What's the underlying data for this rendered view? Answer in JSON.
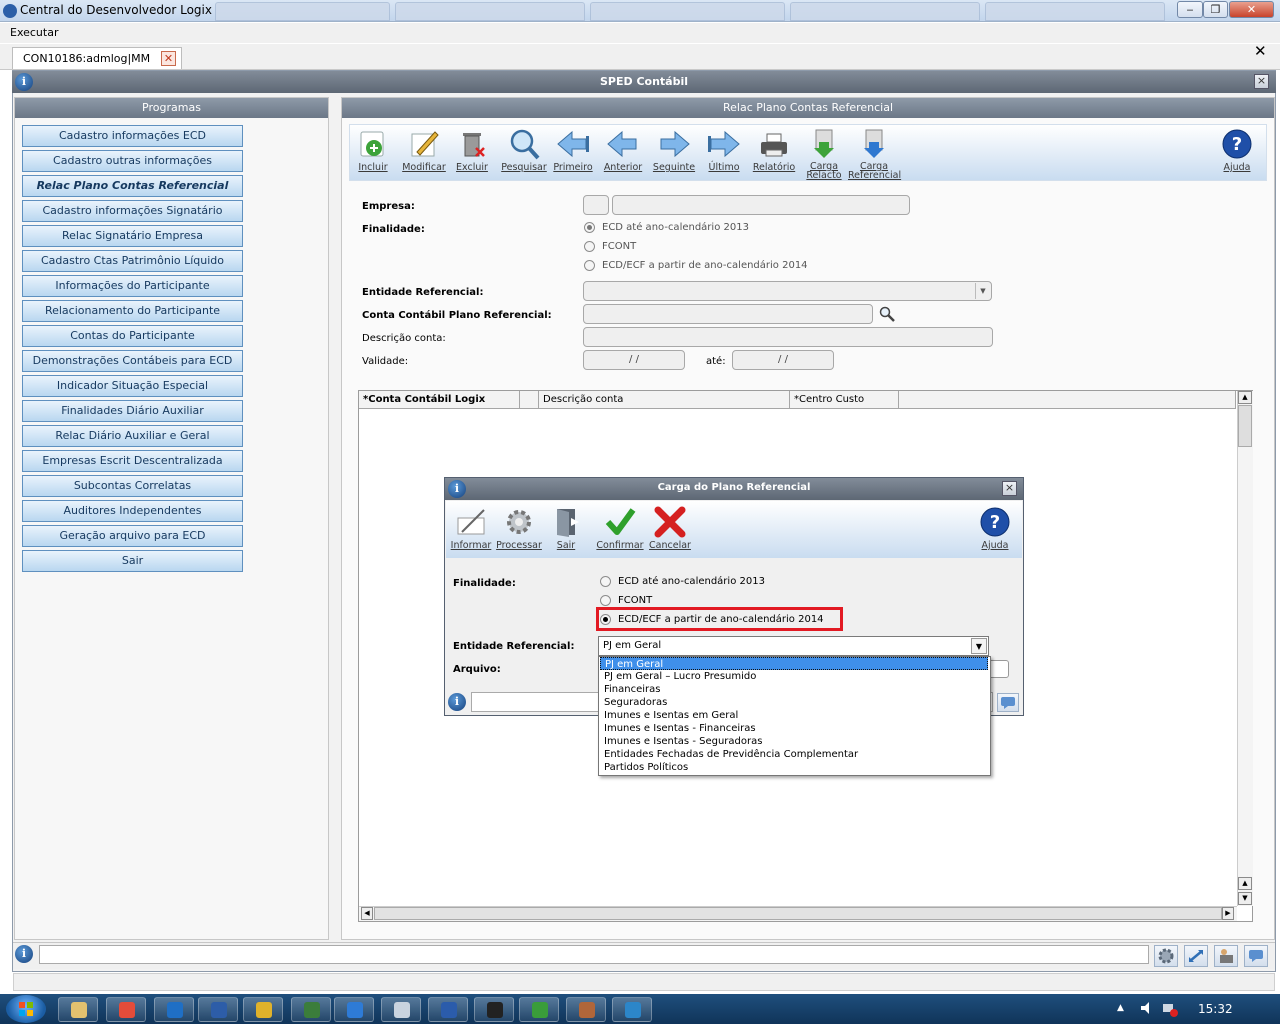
{
  "window": {
    "title": "Central do Desenvolvedor Logix",
    "minimize": "‒",
    "restore": "❐",
    "close": "✕"
  },
  "menu": {
    "executar": "Executar"
  },
  "tab": {
    "label": "CON10186:admlog|MM",
    "close_symbol": "✕",
    "strip_close": "✕"
  },
  "frame": {
    "title": "SPED Contábil",
    "close": "×",
    "logo": "i"
  },
  "left_panel": {
    "header": "Programas",
    "items": [
      "Cadastro informações ECD",
      "Cadastro outras informações",
      "Relac Plano Contas Referencial",
      "Cadastro informações Signatário",
      "Relac Signatário Empresa",
      "Cadastro Ctas Patrimônio Líquido",
      "Informações do Participante",
      "Relacionamento do Participante",
      "Contas do Participante",
      "Demonstrações Contábeis para ECD",
      "Indicador Situação Especial",
      "Finalidades Diário Auxiliar",
      "Relac Diário Auxiliar e Geral",
      "Empresas Escrit Descentralizada",
      "Subcontas Correlatas",
      "Auditores Independentes",
      "Geração arquivo para ECD",
      "Sair"
    ],
    "active_index": 2
  },
  "right_panel": {
    "header": "Relac Plano Contas Referencial",
    "toolbar": {
      "incluir": "Incluir",
      "modificar": "Modificar",
      "excluir": "Excluir",
      "pesquisar": "Pesquisar",
      "primeiro": "Primeiro",
      "anterior": "Anterior",
      "seguinte": "Seguinte",
      "ultimo": "Último",
      "relatorio": "Relatório",
      "carga_relacto_1": "Carga",
      "carga_relacto_2": "Relacto",
      "carga_referencial_1": "Carga",
      "carga_referencial_2": "Referencial",
      "ajuda": "Ajuda"
    },
    "form": {
      "empresa_label": "Empresa:",
      "finalidade_label": "Finalidade:",
      "finalidade_options": [
        "ECD até ano-calendário 2013",
        "FCONT",
        "ECD/ECF a partir de ano-calendário 2014"
      ],
      "finalidade_selected": 0,
      "entidade_label": "Entidade Referencial:",
      "conta_label": "Conta Contábil Plano Referencial:",
      "descricao_label": "Descrição conta:",
      "validade_label": "Validade:",
      "validade_from": "/ /",
      "ate_label": "até:",
      "validade_to": "/ /"
    },
    "grid": {
      "columns": [
        "*Conta Contábil Logix",
        "",
        "Descrição conta",
        "*Centro Custo"
      ]
    }
  },
  "dialog": {
    "title": "Carga do Plano Referencial",
    "close": "×",
    "toolbar": {
      "informar": "Informar",
      "processar": "Processar",
      "sair": "Sair",
      "confirmar": "Confirmar",
      "cancelar": "Cancelar",
      "ajuda": "Ajuda"
    },
    "finalidade_label": "Finalidade:",
    "finalidade_options": [
      "ECD até ano-calendário 2013",
      "FCONT",
      "ECD/ECF a partir de ano-calendário 2014"
    ],
    "finalidade_selected": 2,
    "entidade_label": "Entidade Referencial:",
    "entidade_value": "PJ em Geral",
    "arquivo_label": "Arquivo:",
    "dropdown_options": [
      "PJ em Geral",
      "PJ em Geral – Lucro Presumido",
      "Financeiras",
      "Seguradoras",
      "Imunes e Isentas em Geral",
      "Imunes e Isentas - Financeiras",
      "Imunes e Isentas - Seguradoras",
      "Entidades Fechadas de Previdência Complementar",
      "Partidos Políticos"
    ],
    "dropdown_selected": 0
  },
  "taskbar": {
    "clock": "15:32",
    "apps": [
      "explorer-icon",
      "chrome-icon",
      "outlook-icon",
      "link-icon",
      "logix-icon",
      "globe-icon",
      "ie-icon",
      "notepad-icon",
      "word-icon",
      "cmd-icon",
      "imt-icon",
      "tool-icon",
      "l-icon"
    ]
  },
  "colors": {
    "accent_red": "#e21a23",
    "button_blue": "#5f90bf",
    "header_gray": "#6b7787"
  }
}
